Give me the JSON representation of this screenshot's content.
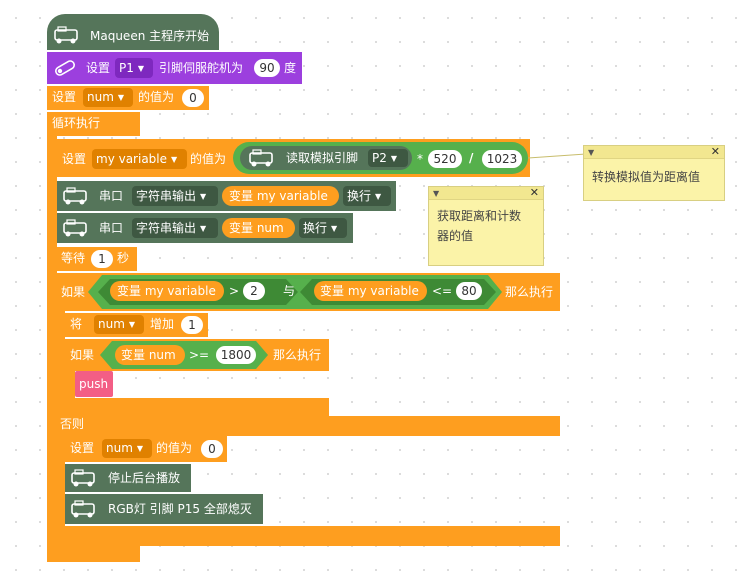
{
  "hat": {
    "label": "Maqueen 主程序开始"
  },
  "servo": {
    "set": "设置",
    "pin": "P1",
    "text": "引脚伺服舵机为",
    "value": "90",
    "unit": "度"
  },
  "setnum": {
    "set": "设置",
    "var": "num",
    "text": "的值为",
    "value": "0"
  },
  "loop": {
    "label": "循环执行"
  },
  "setmy": {
    "set": "设置",
    "var": "my variable",
    "text": "的值为",
    "read": "读取模拟引脚",
    "pin": "P2",
    "mul": "*",
    "v1": "520",
    "div": "/",
    "v2": "1023"
  },
  "serial1": {
    "label": "串口",
    "mode": "字符串输出",
    "var": "变量 my variable",
    "nl": "换行"
  },
  "serial2": {
    "label": "串口",
    "mode": "字符串输出",
    "var": "变量 num",
    "nl": "换行"
  },
  "wait": {
    "label": "等待",
    "value": "1",
    "unit": "秒"
  },
  "if1": {
    "if": "如果",
    "lhs": "变量 my variable",
    "gt": ">",
    "v": "2",
    "and": "与",
    "rhs": "变量 my variable",
    "le": "<=",
    "v2": "80",
    "then": "那么执行"
  },
  "inc": {
    "label": "将",
    "var": "num",
    "text": "增加",
    "value": "1"
  },
  "if2": {
    "if": "如果",
    "lhs": "变量 num",
    "ge": ">=",
    "v": "1800",
    "then": "那么执行"
  },
  "push": {
    "label": "push"
  },
  "else": {
    "label": "否则"
  },
  "setnum2": {
    "set": "设置",
    "var": "num",
    "text": "的值为",
    "value": "0"
  },
  "stop": {
    "label": "停止后台播放"
  },
  "rgb": {
    "label": "RGB灯 引脚 P15 全部熄灭"
  },
  "note1": {
    "text": "转换模拟值为距离值"
  },
  "note2": {
    "line1": "获取距离和计数",
    "line2": "器的值"
  },
  "colors": {
    "control": "#fe9e1f",
    "math": "#56b04c",
    "maqueen": "#55755a",
    "servo": "#9c3fde",
    "note": "#fbf3a8"
  }
}
